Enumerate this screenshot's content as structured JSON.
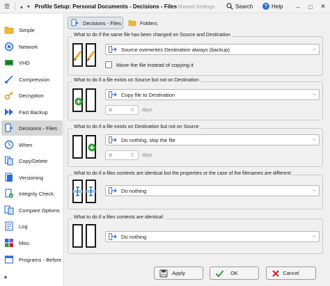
{
  "window": {
    "title": "Profile Setup: Personal Documents - Decisions - Files",
    "shared_settings": "Shared Settings",
    "search_label": "Search",
    "help_label": "Help"
  },
  "sidebar": {
    "items": [
      {
        "label": "Simple",
        "icon": "folder-icon"
      },
      {
        "label": "Network",
        "icon": "network-icon"
      },
      {
        "label": "VHD",
        "icon": "vhd-icon"
      },
      {
        "label": "Compression",
        "icon": "compression-icon"
      },
      {
        "label": "Decryption",
        "icon": "key-icon"
      },
      {
        "label": "Fast Backup",
        "icon": "fast-forward-icon"
      },
      {
        "label": "Decisions - Files",
        "icon": "decisions-icon",
        "active": true
      },
      {
        "label": "When",
        "icon": "clock-icon"
      },
      {
        "label": "Copy/Delete",
        "icon": "copy-icon"
      },
      {
        "label": "Versioning",
        "icon": "versioning-icon"
      },
      {
        "label": "Integrity Check",
        "icon": "integrity-check-icon"
      },
      {
        "label": "Compare Options",
        "icon": "compare-icon"
      },
      {
        "label": "Log",
        "icon": "log-icon"
      },
      {
        "label": "Misc.",
        "icon": "misc-icon"
      },
      {
        "label": "Programs - Before",
        "icon": "programs-icon"
      }
    ]
  },
  "tabs": [
    {
      "label": "Decisions - Files",
      "active": true
    },
    {
      "label": "Folders",
      "active": false
    }
  ],
  "groups": [
    {
      "label": "What to do if the same file has been changed on Source and Destination",
      "select": "Source overwrites Destination always (backup)",
      "checkbox_label": "Move the file instead of copying it"
    },
    {
      "label": "What to do if a file exists on Source but not on Destination",
      "select": "Copy file to Destination",
      "days_value": "0",
      "days_unit": "days"
    },
    {
      "label": "What to do if a file exists on Destination but not on Source",
      "select": "Do nothing, skip the file",
      "days_value": "0",
      "days_unit": "days"
    },
    {
      "label": "What to do if a files contents are identical but the properties or the case of the filenames are different:",
      "select": "Do nothing"
    },
    {
      "label": "What to do if a files contents are identical:",
      "select": "Do nothing"
    }
  ],
  "buttons": {
    "apply": "Apply",
    "ok": "OK",
    "cancel": "Cancel"
  },
  "colors": {
    "accent_blue": "#2b6cd6",
    "ok_green": "#2e9a3a",
    "cancel_red": "#d42020",
    "orange_pencil": "#f5a623",
    "green_plus": "#2e9a3a"
  }
}
